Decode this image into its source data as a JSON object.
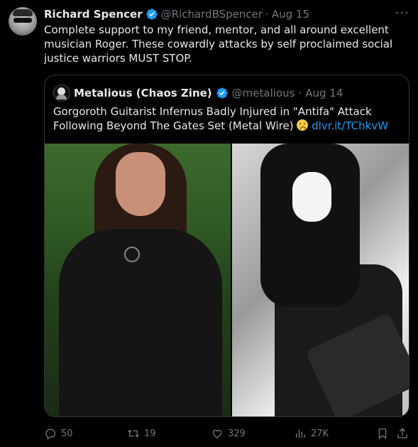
{
  "tweet": {
    "name": "Richard Spencer",
    "handle": "@RichardBSpencer",
    "separator": "·",
    "date": "Aug 15",
    "more_icon": "more-dots-icon",
    "text": "Complete support to my friend, mentor, and all around excellent musician Roger. These cowardly attacks by self proclaimed social justice warriors MUST STOP."
  },
  "quote": {
    "name": "Metalious (Chaos Zine)",
    "handle": "@metalious",
    "separator": "·",
    "date": "Aug 14",
    "text": "Gorgoroth Guitarist Infernus Badly Injured in \"Antifa\" Attack Following Beyond The Gates Set (Metal Wire)",
    "link": "dlvr.it/TChkvW"
  },
  "actions": {
    "replies": "50",
    "retweets": "19",
    "likes": "329",
    "views": "27K"
  },
  "colors": {
    "background": "#000000",
    "text": "#e7e9ea",
    "muted": "#71767b",
    "link": "#1d9bf0",
    "border": "#2f3336",
    "verified": "#1d9bf0"
  }
}
